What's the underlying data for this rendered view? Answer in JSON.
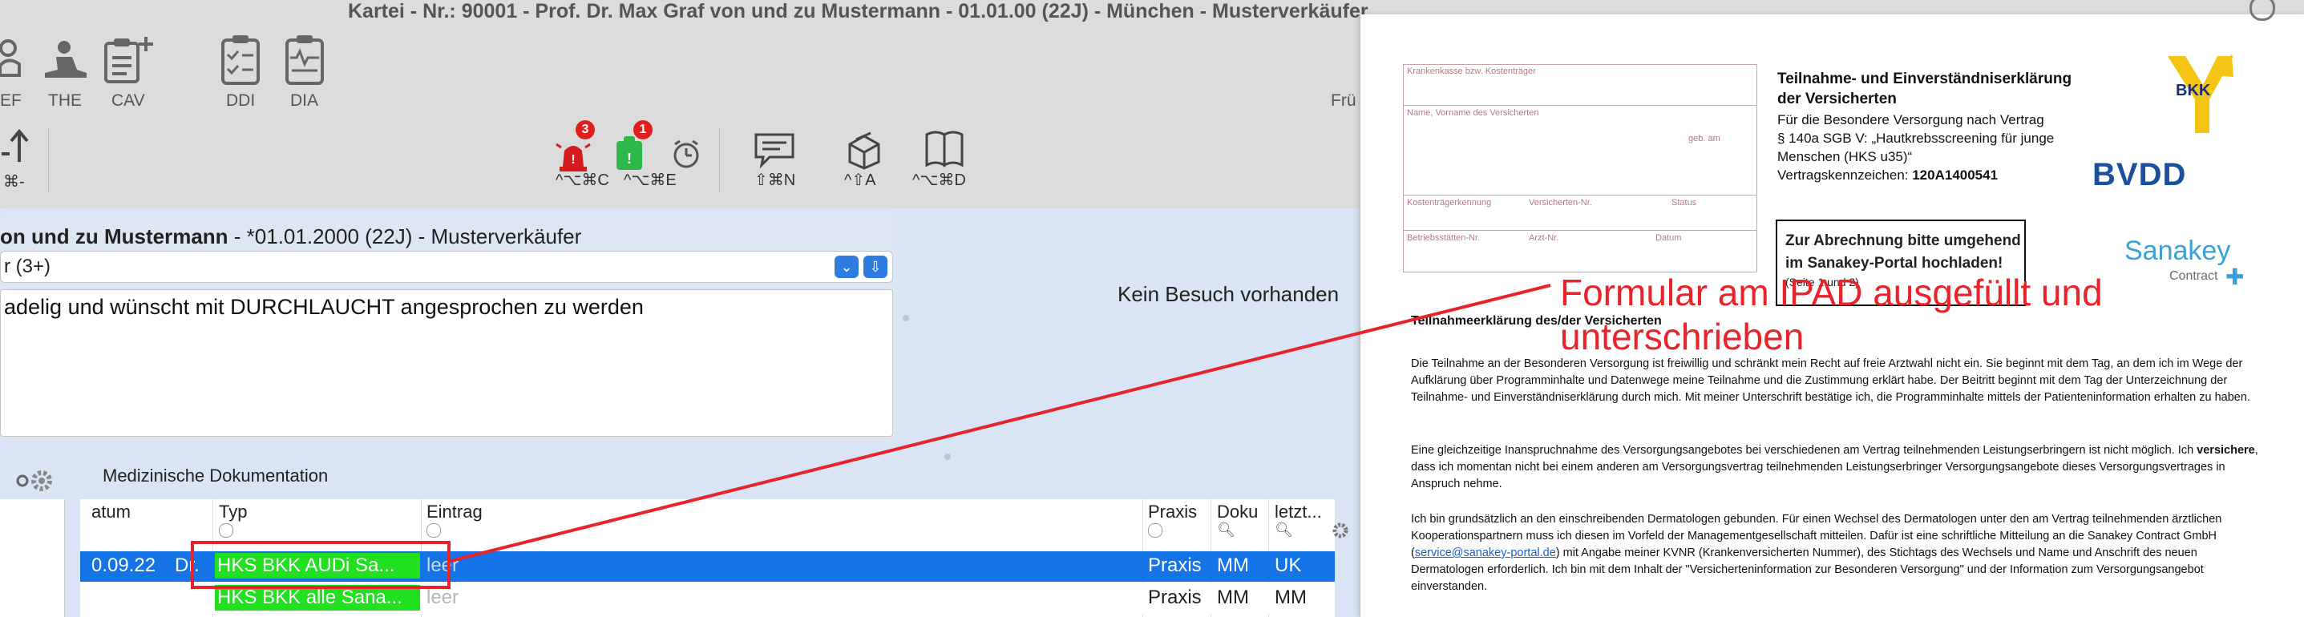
{
  "window": {
    "title": "Kartei - Nr.: 90001 - Prof. Dr. Max Graf von und zu Mustermann - 01.01.00 (22J) - München - Musterverkäufer"
  },
  "toolbar1": {
    "items": [
      {
        "label": "EF",
        "icon": "clipboard-person-icon"
      },
      {
        "label": "THE",
        "icon": "therapy-person-icon"
      },
      {
        "label": "CAV",
        "icon": "clipboard-plus-icon"
      },
      {
        "label": "DDI",
        "icon": "checklist-icon"
      },
      {
        "label": "DIA",
        "icon": "pulse-clipboard-icon"
      }
    ],
    "right_label": "Frü"
  },
  "toolbar2": {
    "left_shortcut": "⌘-",
    "items": [
      {
        "shortcut": "^⌥⌘C",
        "icon": "alarm-siren-icon",
        "badge": "3"
      },
      {
        "shortcut": "",
        "icon": "green-badge-icon",
        "badge": "1"
      },
      {
        "shortcut": "^⌥⌘E",
        "icon": "alarm-clock-icon"
      },
      {
        "shortcut": "⇧⌘N",
        "icon": "speech-bubble-icon"
      },
      {
        "shortcut": "^⇧A",
        "icon": "cube-stack-icon"
      },
      {
        "shortcut": "^⌥⌘D",
        "icon": "book-icon"
      }
    ]
  },
  "patient": {
    "name_bold": "on und zu Mustermann",
    "name_rest": " - *01.01.2000 (22J) - Musterverkäufer",
    "combo_value": "r (3+)",
    "note": "adelig und wünscht mit DURCHLAUCHT angesprochen zu werden"
  },
  "visit_status": "Kein Besuch vorhanden",
  "med_doc": {
    "label": "Medizinische Dokumentation",
    "columns": [
      "atum",
      "Typ",
      "Eintrag",
      "Praxis",
      "Doku",
      "letzt..."
    ],
    "rows": [
      {
        "datum": "0.09.22",
        "extra": "Dr.",
        "typ": "HKS BKK AUDi Sa...",
        "eintrag": "leer",
        "praxis": "Praxis",
        "doku": "MM",
        "letzt": "UK"
      },
      {
        "datum": "",
        "extra": "",
        "typ": "HKS BKK alle Sana...",
        "eintrag": "leer",
        "praxis": "Praxis",
        "doku": "MM",
        "letzt": "MM"
      }
    ]
  },
  "annotation": {
    "text_line1": "Formular am IPAD ausgefüllt und",
    "text_line2": "unterschrieben",
    "color": "#e8232a"
  },
  "document": {
    "form_fields": {
      "kasse": "Krankenkasse bzw. Kostenträger",
      "name": "Name, Vorname des Versicherten",
      "geb": "geb. am",
      "kennung": "Kostenträgerkennung",
      "versnr": "Versicherten-Nr.",
      "status": "Status",
      "bsnr": "Betriebsstätten-Nr.",
      "arztnr": "Arzt-Nr.",
      "datum": "Datum"
    },
    "heading1": "Teilnahme- und Einverständniserklärung",
    "heading2": "der Versicherten",
    "sub1": "Für die Besondere Versorgung nach Vertrag",
    "sub2": "§ 140a SGB V: „Hautkrebsscreening für junge",
    "sub3": "Menschen (HKS u35)“",
    "vk_label": "Vertragskennzeichen: ",
    "vk_value": "120A1400541",
    "box1": "Zur Abrechnung bitte umgehend",
    "box2": "im Sanakey-Portal hochladen!",
    "box3": "(Seite 1 und 2)",
    "logo_bkk": "BKK",
    "logo_bvd": "BVDD",
    "logo_sanakey": "Sanakey",
    "logo_contract": "Contract",
    "section_title": "Teilnahmeerklärung des/der Versicherten",
    "p1": "Die Teilnahme an der Besonderen Versorgung ist freiwillig und schränkt mein Recht auf freie Arztwahl nicht ein. Sie beginnt mit dem Tag, an dem ich im Wege der Aufklärung über Programminhalte und Datenwege meine Teilnahme und die Zustimmung erklärt habe. Der Beitritt beginnt mit dem Tag der Unterzeichnung der Teilnahme- und Einverständniserklärung durch mich. Mit meiner Unterschrift bestätige ich, die Programminhalte mittels der Patienteninformation erhalten zu haben.",
    "p2a": "Eine gleichzeitige Inanspruchnahme des Versorgungsangebotes bei verschiedenen am Vertrag teilnehmenden Leistungserbringern ist nicht möglich. Ich ",
    "p2b": "versichere",
    "p2c": ", dass ich momentan nicht bei einem anderen am Versorgungsvertrag teilnehmenden Leistungserbringer Versorgungsangebote dieses Versorgungsvertrages in Anspruch nehme.",
    "p3a": "Ich bin grundsätzlich an den einschreibenden Dermatologen gebunden. Für einen Wechsel des Dermatologen unter den am Vertrag teilnehmenden ärztlichen Kooperationspartnern muss ich diesen im Vorfeld der Managementgesellschaft mitteilen. Dafür ist eine schriftliche Mitteilung an die Sanakey Contract GmbH (",
    "p3link": "service@sanakey-portal.de",
    "p3b": ") mit Angabe meiner KVNR (Krankenversicherten Nummer), des Stichtags des Wechsels und Name und Anschrift des neuen Dermatologen erforderlich. Ich bin mit dem Inhalt der \"Versicherteninformation zur Besonderen Versorgung\" und der Information zum Versorgungsangebot einverstanden."
  }
}
